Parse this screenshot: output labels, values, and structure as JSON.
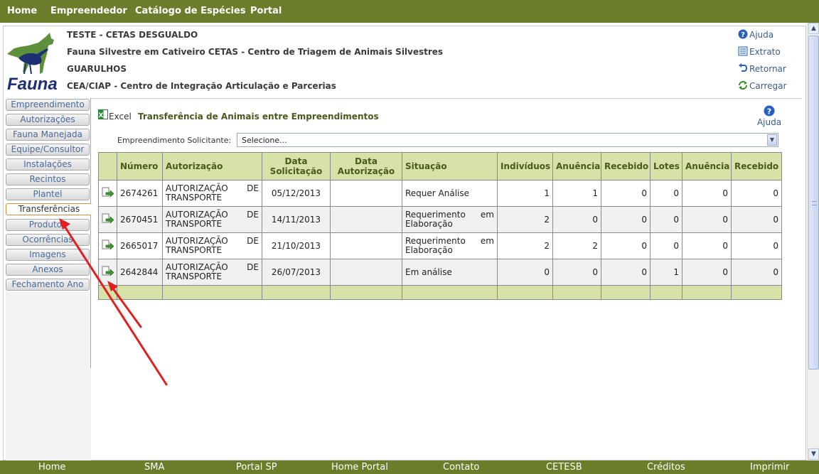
{
  "top_nav": [
    "Home",
    "Empreendedor",
    "Catálogo de Espécies",
    "Portal"
  ],
  "header": {
    "line1": "TESTE - CETAS DESGUALDO",
    "line2": "Fauna Silvestre em Cativeiro CETAS - Centro de Triagem de Animais Silvestres",
    "line3": "GUARULHOS",
    "line4": "CEA/CIAP - Centro de Integração Articulação e Parcerias",
    "logo_text": "Fauna"
  },
  "right_links": {
    "help": "Ajuda",
    "extract": "Extrato",
    "back": "Retornar",
    "reload": "Carregar"
  },
  "sidebar": {
    "items": [
      "Empreendimento",
      "Autorizações",
      "Fauna Manejada",
      "Equipe/Consultor",
      "Instalações",
      "Recintos",
      "Plantel",
      "Transferências",
      "Produtos",
      "Ocorrências",
      "Imagens",
      "Anexos",
      "Fechamento Ano"
    ],
    "active": "Transferências"
  },
  "content": {
    "excel_label": "Excel",
    "title": "Transferência de Animais entre Empreendimentos",
    "help_label": "Ajuda",
    "select_label": "Empreendimento Solicitante:",
    "select_value": "Selecione..."
  },
  "table": {
    "headers": [
      "Número",
      "Autorização",
      "Data Solicitação",
      "Data Autorização",
      "Situação",
      "Indivíduos",
      "Anuência",
      "Recebido",
      "Lotes",
      "Anuência",
      "Recebido"
    ],
    "rows": [
      {
        "numero": "2674261",
        "aut1": "AUTORIZAÇÃO DE",
        "aut2": "TRANSPORTE",
        "data_sol": "05/12/2013",
        "data_aut": "",
        "sit1": "Requer Análise",
        "sit2": "",
        "indiv": "1",
        "anu1": "1",
        "rec1": "0",
        "lotes": "0",
        "anu2": "0",
        "rec2": "0"
      },
      {
        "numero": "2670451",
        "aut1": "AUTORIZAÇÃO DE",
        "aut2": "TRANSPORTE",
        "data_sol": "14/11/2013",
        "data_aut": "",
        "sit1": "Requerimento em",
        "sit2": "Elaboração",
        "indiv": "2",
        "anu1": "0",
        "rec1": "0",
        "lotes": "0",
        "anu2": "0",
        "rec2": "0"
      },
      {
        "numero": "2665017",
        "aut1": "AUTORIZAÇÃO DE",
        "aut2": "TRANSPORTE",
        "data_sol": "21/10/2013",
        "data_aut": "",
        "sit1": "Requerimento em",
        "sit2": "Elaboração",
        "indiv": "2",
        "anu1": "2",
        "rec1": "0",
        "lotes": "0",
        "anu2": "0",
        "rec2": "0"
      },
      {
        "numero": "2642844",
        "aut1": "AUTORIZAÇÃO DE",
        "aut2": "TRANSPORTE",
        "data_sol": "26/07/2013",
        "data_aut": "",
        "sit1": "Em análise",
        "sit2": "",
        "indiv": "0",
        "anu1": "0",
        "rec1": "0",
        "lotes": "1",
        "anu2": "0",
        "rec2": "0"
      }
    ]
  },
  "bottom_nav": [
    "Home",
    "SMA",
    "Portal SP",
    "Home Portal",
    "Contato",
    "CETESB",
    "Créditos",
    "Imprimir"
  ],
  "colors": {
    "nav_green": "#6b7d2b",
    "header_green": "#d6e2a8",
    "annotation_red": "#e02020"
  }
}
